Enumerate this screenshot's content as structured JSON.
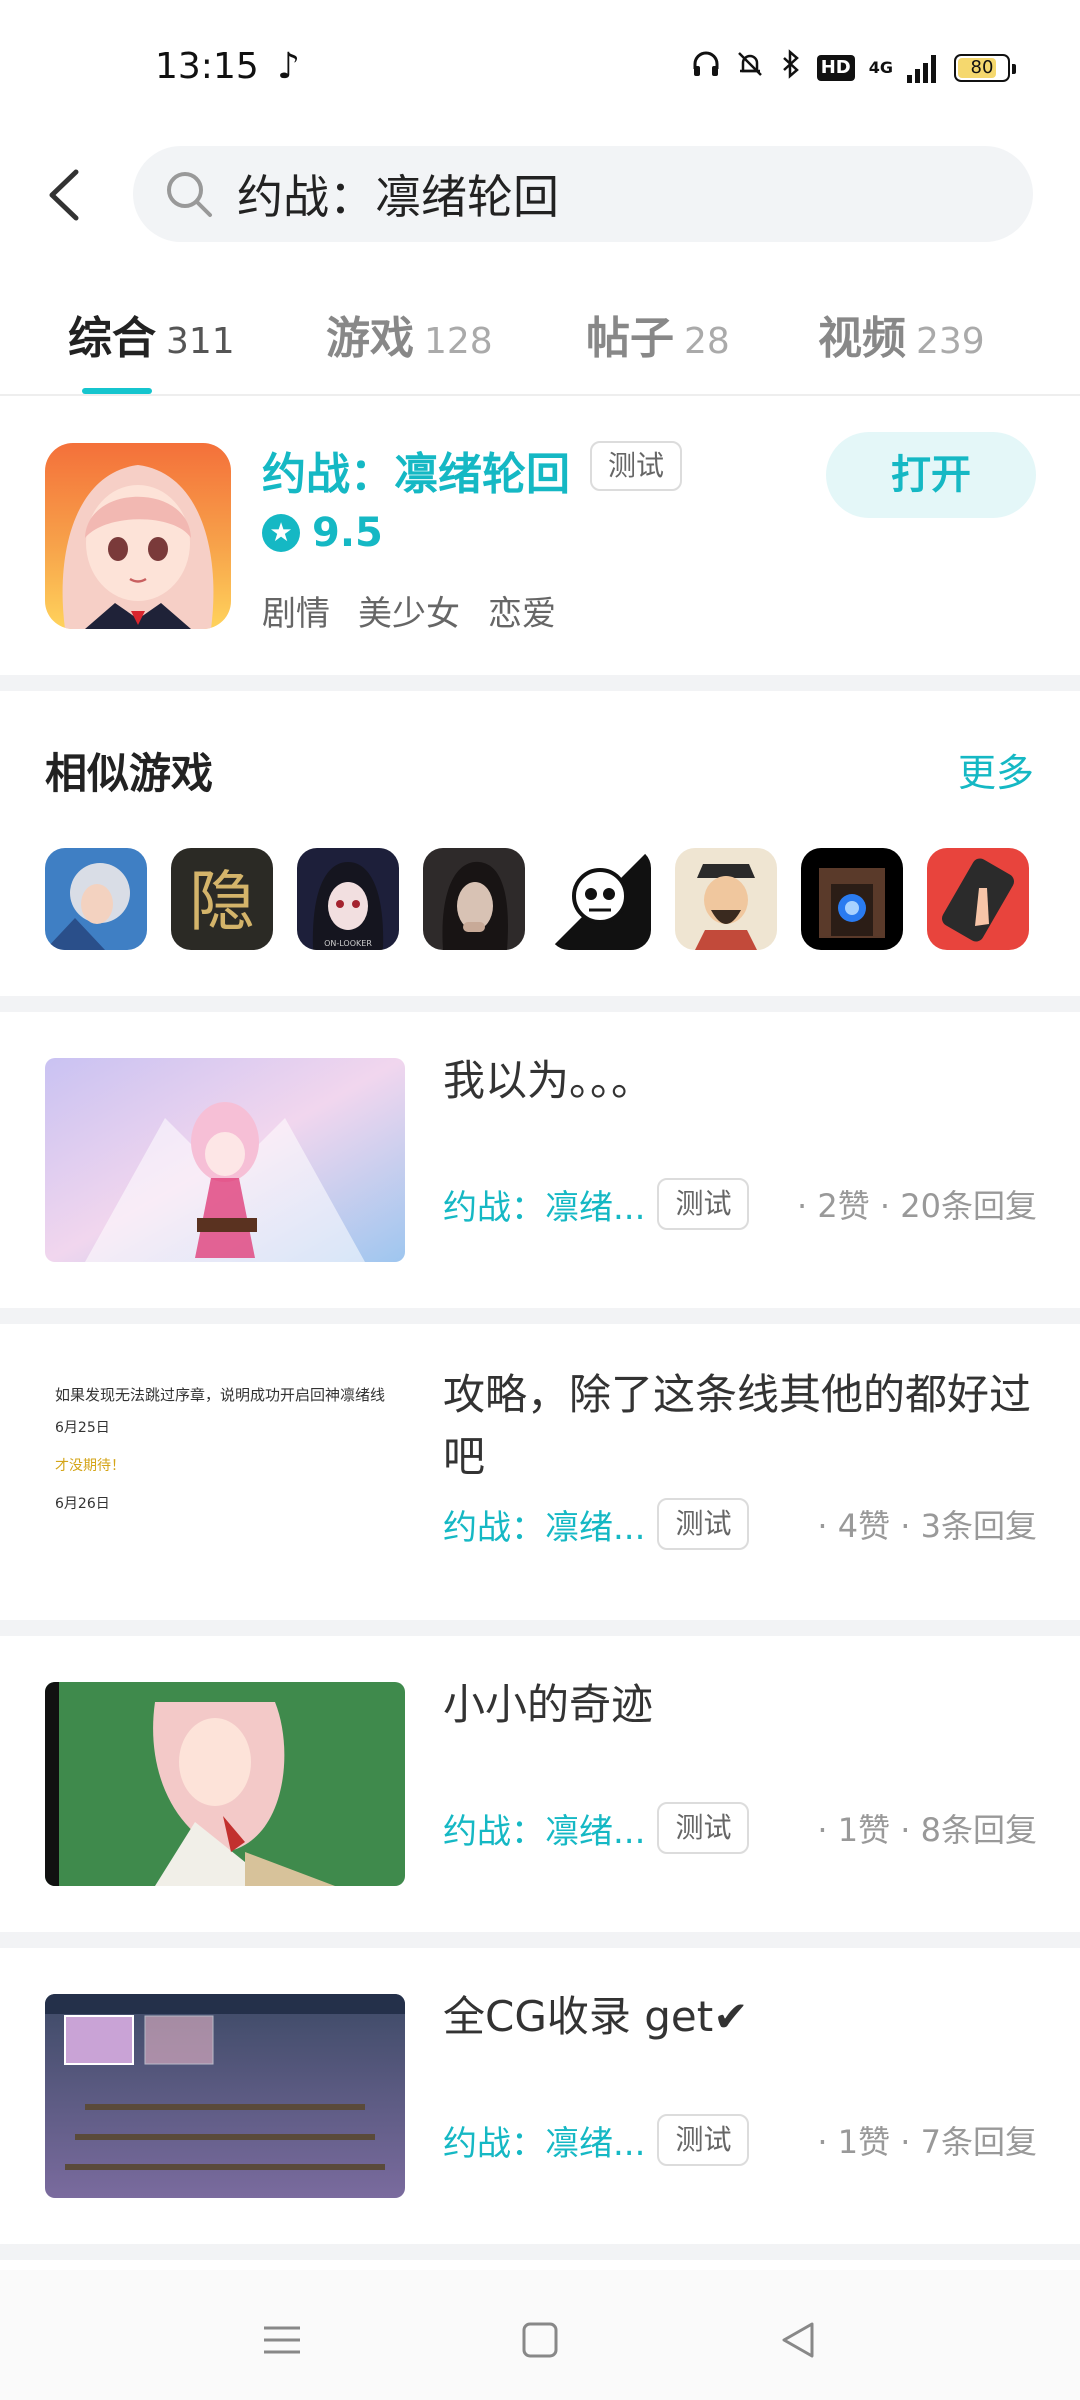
{
  "status_bar": {
    "time": "13:15",
    "network": "4G",
    "hd": "HD",
    "battery": "80",
    "battery_level": 0.8
  },
  "search": {
    "query": "约战：凛绪轮回"
  },
  "tabs": [
    {
      "label": "综合",
      "count": "311",
      "active": true
    },
    {
      "label": "游戏",
      "count": "128",
      "active": false
    },
    {
      "label": "帖子",
      "count": "28",
      "active": false
    },
    {
      "label": "视频",
      "count": "239",
      "active": false
    }
  ],
  "game": {
    "title": "约战：凛绪轮回",
    "badge": "测试",
    "rating": "9.5",
    "tags": [
      "剧情",
      "美少女",
      "恋爱"
    ],
    "open_label": "打开"
  },
  "similar": {
    "title": "相似游戏",
    "more_label": "更多",
    "icons": [
      "game-icon-1",
      "game-icon-2",
      "game-icon-3",
      "game-icon-4",
      "game-icon-5",
      "game-icon-6",
      "game-icon-7",
      "game-icon-8"
    ],
    "icon_glyph_2": "隐",
    "icon_text_3": "ON-LOOKER"
  },
  "posts": [
    {
      "title": "我以为。。。",
      "game": "约战：凛绪...",
      "badge": "测试",
      "stats": "· 2赞 · 20条回复"
    },
    {
      "title": "攻略，除了这条线其他的都好过吧",
      "game": "约战：凛绪...",
      "badge": "测试",
      "stats": "· 4赞 · 3条回复",
      "thumb_lines": [
        "如果发现无法跳过序章，说明成功开启回神凛绪线",
        "6月25日",
        "才没期待！",
        "6月26日"
      ]
    },
    {
      "title": "小小的奇迹",
      "game": "约战：凛绪...",
      "badge": "测试",
      "stats": "· 1赞 · 8条回复"
    },
    {
      "title": "全CG收录 get✔",
      "game": "约战：凛绪...",
      "badge": "测试",
      "stats": "· 1赞 · 7条回复"
    }
  ],
  "colors": {
    "accent": "#15b8c4",
    "tab_indicator": "#15c5ce",
    "open_button_bg": "#e4f7f8",
    "divider": "#f2f3f5"
  }
}
